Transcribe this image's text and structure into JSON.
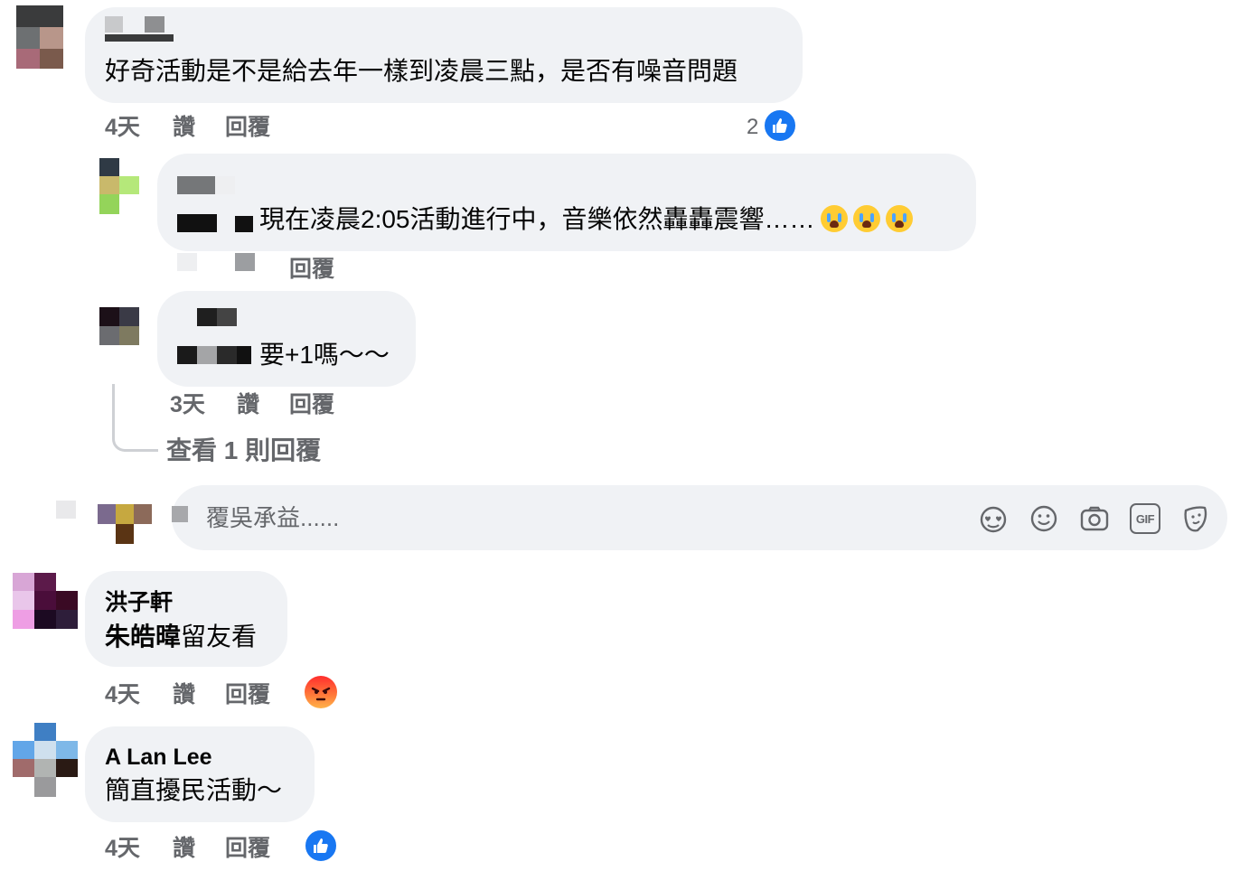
{
  "comments": [
    {
      "name": "",
      "text": "好奇活動是不是給去年一樣到凌晨三點，是否有噪音問題",
      "time": "4天",
      "like_label": "讚",
      "reply_label": "回覆",
      "reaction_count": "2",
      "reaction": "like-reaction"
    },
    {
      "name": "",
      "mention": "",
      "text": "現在凌晨2:05活動進行中，音樂依然轟轟震響……",
      "emojis": [
        "loudly-crying-face",
        "loudly-crying-face",
        "loudly-crying-face"
      ],
      "time": "",
      "like_label": "",
      "reply_label": "回覆"
    },
    {
      "name": "",
      "text": "要+1嗎～～",
      "time": "3天",
      "like_label": "讚",
      "reply_label": "回覆",
      "view_replies": "查看 1 則回覆"
    },
    {
      "name": "洪子軒",
      "mention": "朱皓暐",
      "text": "留友看",
      "time": "4天",
      "like_label": "讚",
      "reply_label": "回覆",
      "reaction": "angry-reaction"
    },
    {
      "name": "A Lan Lee",
      "text": "簡直擾民活動～",
      "time": "4天",
      "like_label": "讚",
      "reply_label": "回覆",
      "reaction": "like-reaction"
    }
  ],
  "reply_input": {
    "placeholder": "覆吳承益......",
    "icons": [
      "avatar-sticker-icon",
      "emoji-icon",
      "camera-icon",
      "gif-icon",
      "sticker-icon"
    ],
    "gif_label": "GIF"
  },
  "colors": {
    "bubble": "#f0f2f5",
    "meta_text": "#65676b",
    "like_blue": "#1877f2"
  }
}
